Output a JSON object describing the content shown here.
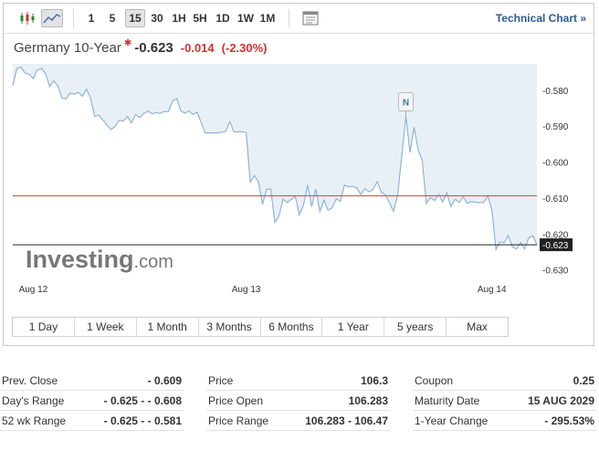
{
  "toolbar": {
    "periods": [
      "1",
      "5",
      "15",
      "30",
      "1H",
      "5H",
      "1D",
      "1W",
      "1M"
    ],
    "active_period": "15",
    "technical_link": "Technical Chart »"
  },
  "instrument": {
    "name": "Germany 10-Year",
    "last": "-0.623",
    "change": "-0.014",
    "change_pct": "(-2.30%)"
  },
  "watermark": {
    "brand": "Investing",
    "suffix": ".com"
  },
  "flag_marker": "N",
  "chart_data": {
    "type": "area",
    "y_ticks": [
      "-0.580",
      "-0.590",
      "-0.600",
      "-0.610",
      "-0.620",
      "-0.630"
    ],
    "ylim": [
      -0.6311,
      -0.5727
    ],
    "x_ticks": [
      "Aug 12",
      "Aug 13",
      "Aug 14"
    ],
    "reference_line": -0.6094,
    "last_line": -0.623,
    "last_label": "-0.623",
    "series": [
      {
        "values": [
          -0.5787,
          -0.574,
          -0.5736,
          -0.5753,
          -0.5755,
          -0.5768,
          -0.5743,
          -0.574,
          -0.5754,
          -0.579,
          -0.5774,
          -0.5788,
          -0.5822,
          -0.5824,
          -0.5808,
          -0.5811,
          -0.5806,
          -0.5817,
          -0.5797,
          -0.5822,
          -0.5873,
          -0.587,
          -0.5883,
          -0.5897,
          -0.591,
          -0.5901,
          -0.5884,
          -0.5886,
          -0.5873,
          -0.5891,
          -0.5868,
          -0.5876,
          -0.5865,
          -0.5858,
          -0.5866,
          -0.5862,
          -0.5865,
          -0.5859,
          -0.586,
          -0.5831,
          -0.5823,
          -0.5857,
          -0.5864,
          -0.5858,
          -0.5868,
          -0.5861,
          -0.589,
          -0.5919,
          -0.5919,
          -0.5919,
          -0.5919,
          -0.5917,
          -0.5915,
          -0.5888,
          -0.5916,
          -0.5916,
          -0.5916,
          -0.5918,
          -0.6056,
          -0.6038,
          -0.6055,
          -0.6118,
          -0.6076,
          -0.6076,
          -0.6167,
          -0.615,
          -0.6103,
          -0.6113,
          -0.6104,
          -0.6095,
          -0.6147,
          -0.612,
          -0.6064,
          -0.6124,
          -0.6075,
          -0.6137,
          -0.6106,
          -0.6134,
          -0.6127,
          -0.6102,
          -0.6109,
          -0.6064,
          -0.6069,
          -0.6067,
          -0.6072,
          -0.609,
          -0.6074,
          -0.6083,
          -0.6076,
          -0.6054,
          -0.6084,
          -0.6091,
          -0.6114,
          -0.6137,
          -0.6091,
          -0.5983,
          -0.5873,
          -0.5973,
          -0.5903,
          -0.5967,
          -0.5995,
          -0.6115,
          -0.6099,
          -0.6107,
          -0.609,
          -0.6111,
          -0.6085,
          -0.6124,
          -0.6103,
          -0.6112,
          -0.6097,
          -0.6115,
          -0.611,
          -0.6112,
          -0.6113,
          -0.6112,
          -0.6094,
          -0.6133,
          -0.6243,
          -0.6222,
          -0.6225,
          -0.6204,
          -0.6236,
          -0.6242,
          -0.6224,
          -0.6242,
          -0.6211,
          -0.6205,
          -0.623
        ]
      }
    ]
  },
  "ranges": [
    "1 Day",
    "1 Week",
    "1 Month",
    "3 Months",
    "6 Months",
    "1 Year",
    "5 years",
    "Max"
  ],
  "stats": [
    [
      {
        "label": "Prev. Close",
        "value": "- 0.609"
      },
      {
        "label": "Day's Range",
        "value": "- 0.625 - - 0.608"
      },
      {
        "label": "52 wk Range",
        "value": "- 0.625 - - 0.581"
      }
    ],
    [
      {
        "label": "Price",
        "value": "106.3"
      },
      {
        "label": "Price Open",
        "value": "106.283"
      },
      {
        "label": "Price Range",
        "value": "106.283 - 106.47"
      }
    ],
    [
      {
        "label": "Coupon",
        "value": "0.25"
      },
      {
        "label": "Maturity Date",
        "value": "15 AUG 2029"
      },
      {
        "label": "1-Year Change",
        "value": "- 295.53%"
      }
    ]
  ],
  "colors": {
    "area_fill": "#e8f0f6",
    "line": "#8fb4d9",
    "reference_line": "#d24a4a",
    "last_line": "#222222",
    "negative": "#d72f2f",
    "link": "#2a5a94"
  }
}
